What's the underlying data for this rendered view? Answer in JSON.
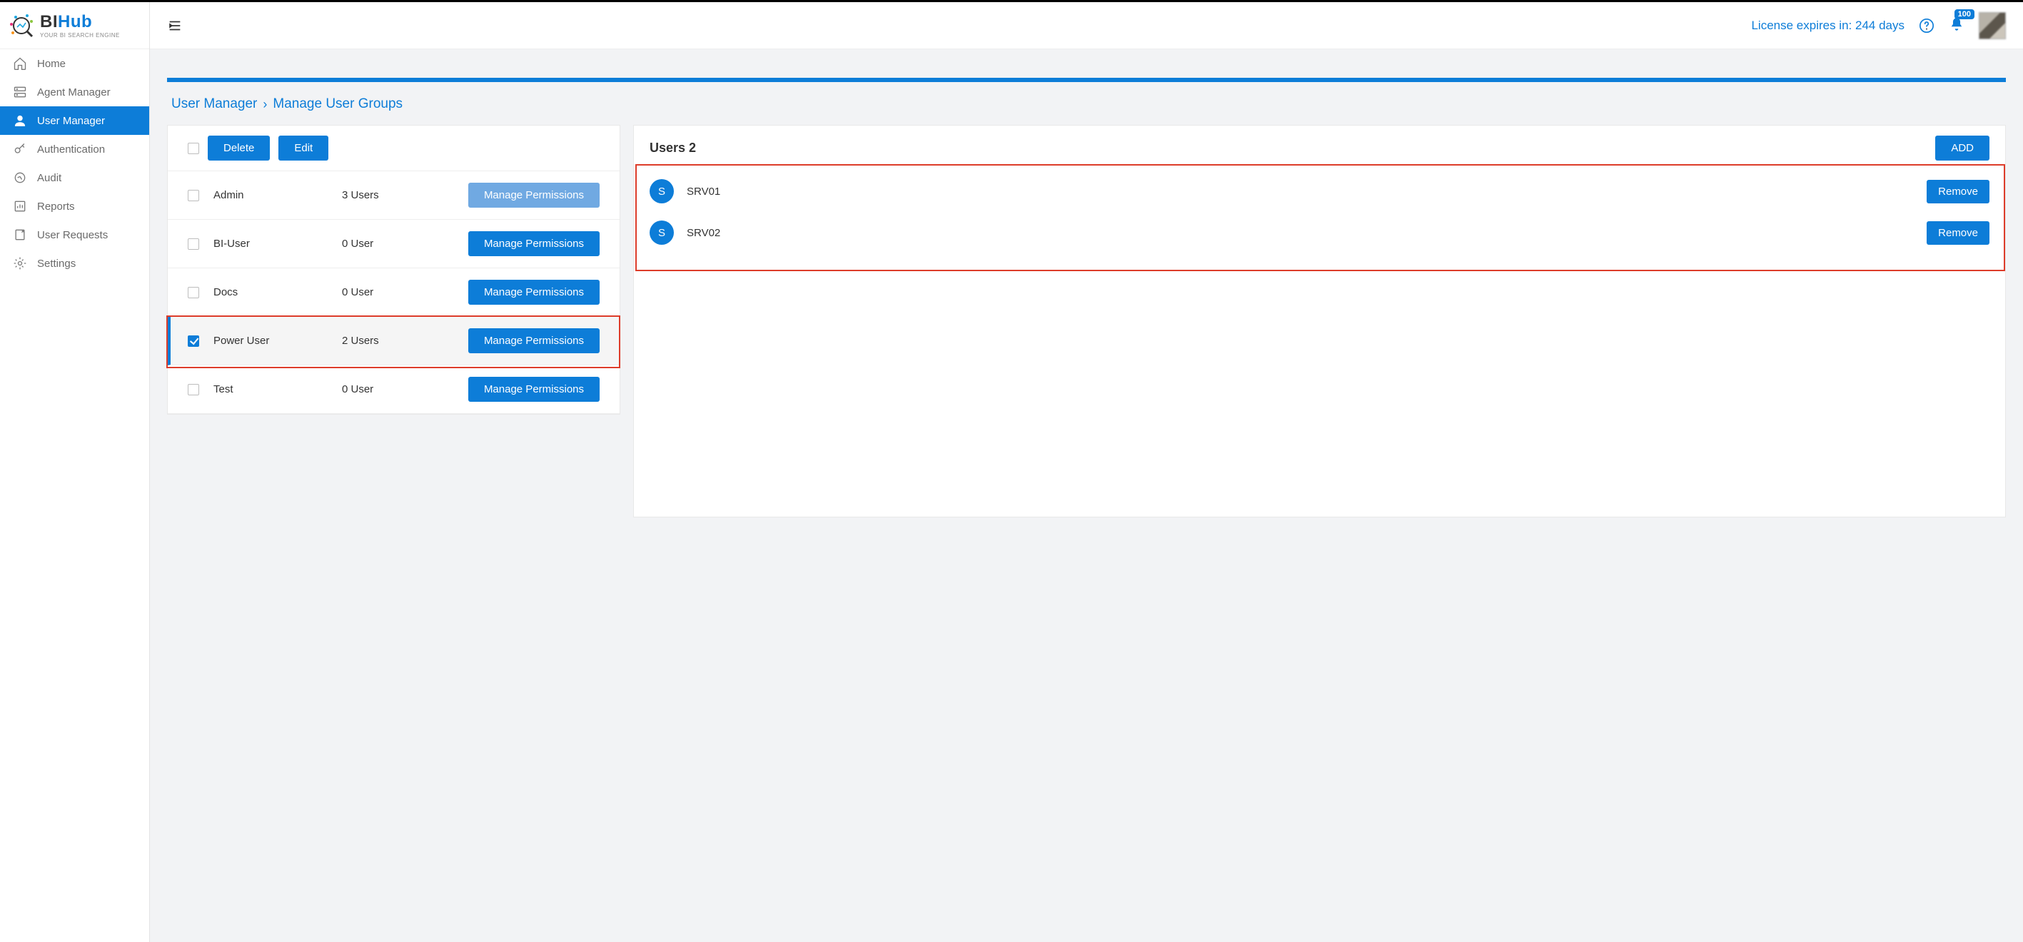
{
  "brand": {
    "bi": "BI",
    "hub": "Hub",
    "tagline": "YOUR BI SEARCH ENGINE"
  },
  "header": {
    "license": "License expires in: 244 days",
    "notif_count": "100"
  },
  "sidebar": {
    "items": [
      {
        "label": "Home"
      },
      {
        "label": "Agent Manager"
      },
      {
        "label": "User Manager"
      },
      {
        "label": "Authentication"
      },
      {
        "label": "Audit"
      },
      {
        "label": "Reports"
      },
      {
        "label": "User Requests"
      },
      {
        "label": "Settings"
      }
    ]
  },
  "breadcrumb": {
    "root": "User Manager",
    "leaf": "Manage User Groups"
  },
  "actions": {
    "delete": "Delete",
    "edit": "Edit",
    "manage_perms": "Manage Permissions",
    "add": "ADD",
    "remove": "Remove"
  },
  "groups": [
    {
      "name": "Admin",
      "count": "3 Users",
      "checked": false,
      "light": true
    },
    {
      "name": "BI-User",
      "count": "0 User",
      "checked": false,
      "light": false
    },
    {
      "name": "Docs",
      "count": "0 User",
      "checked": false,
      "light": false
    },
    {
      "name": "Power User",
      "count": "2 Users",
      "checked": true,
      "light": false
    },
    {
      "name": "Test",
      "count": "0 User",
      "checked": false,
      "light": false
    }
  ],
  "users_panel": {
    "title": "Users 2"
  },
  "users": [
    {
      "initial": "S",
      "name": "SRV01"
    },
    {
      "initial": "S",
      "name": "SRV02"
    }
  ]
}
